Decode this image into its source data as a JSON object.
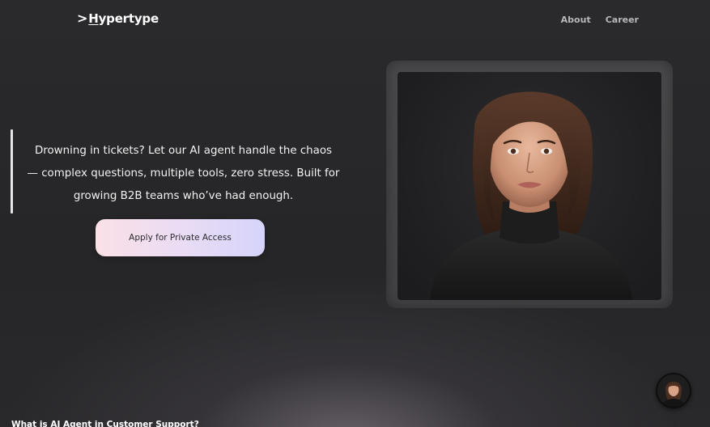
{
  "header": {
    "logo_chevron": ">",
    "logo_first_letter": "H",
    "logo_rest": "ypertype",
    "nav": [
      {
        "label": "About"
      },
      {
        "label": "Career"
      }
    ]
  },
  "hero": {
    "lines": [
      "Drowning in tickets? Let our AI agent handle the chaos",
      "— complex questions, multiple tools, zero stress. Built for",
      "growing B2B teams who’ve had enough."
    ],
    "cta_label": "Apply for Private Access"
  },
  "portrait": {
    "icon": "ai-agent-portrait"
  },
  "chat_widget": {
    "icon": "chat-avatar-icon"
  },
  "next_section": {
    "heading": "What is AI Agent in Customer Support?"
  },
  "colors": {
    "background": "#262628",
    "cta_gradient_start": "#fbe0e6",
    "cta_gradient_end": "#d6d4fb",
    "nav_text": "#b8b8bc"
  }
}
